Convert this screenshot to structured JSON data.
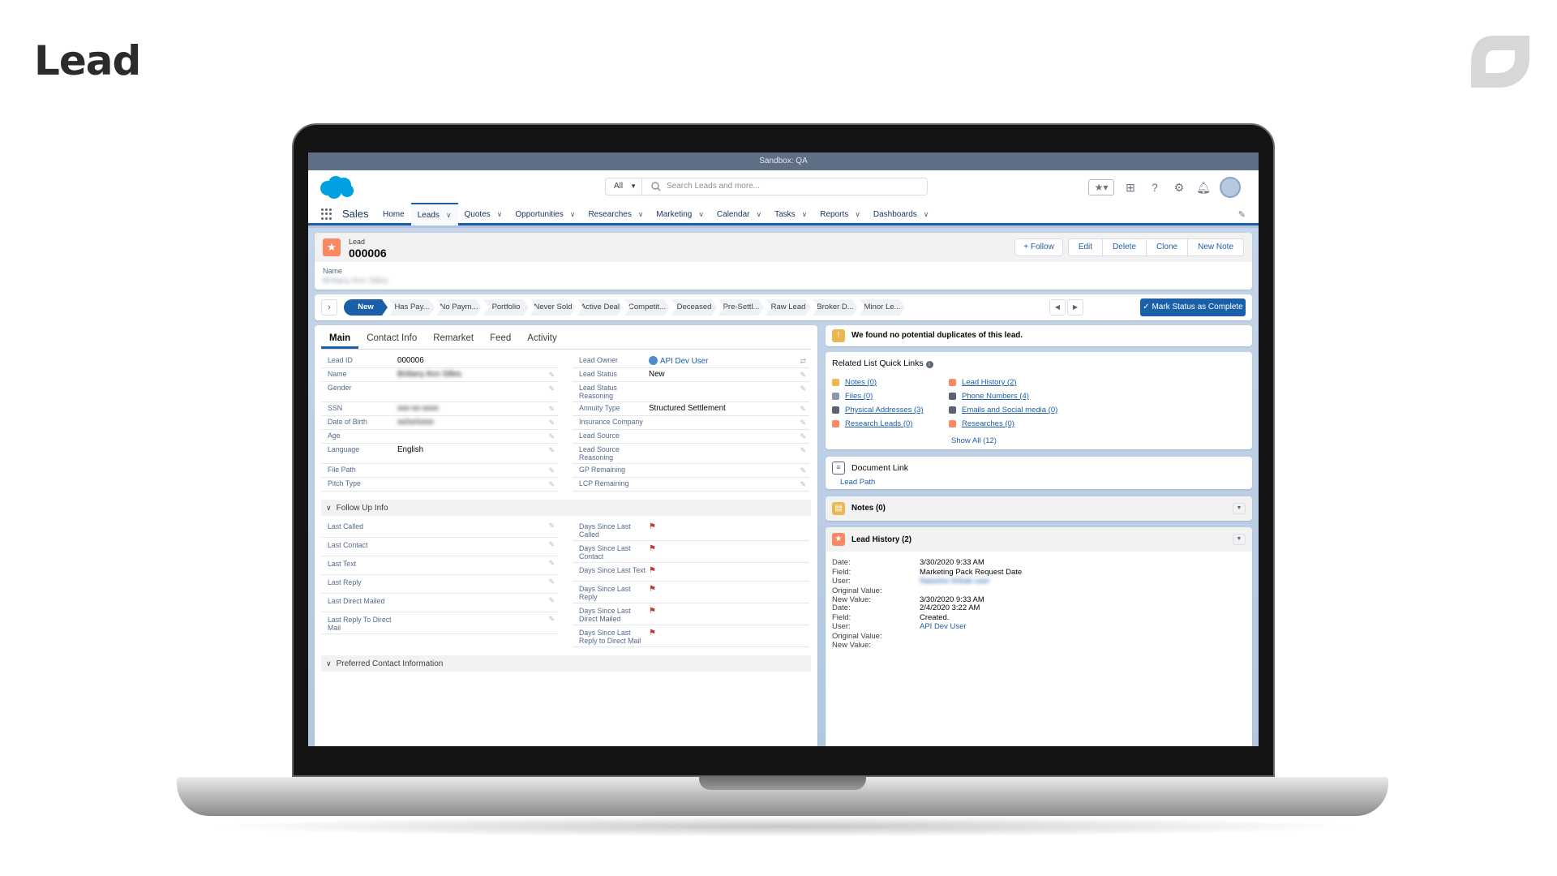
{
  "page": {
    "title": "Lead"
  },
  "sandbox": {
    "label": "Sandbox: QA"
  },
  "header": {
    "search_scope": "All",
    "search_placeholder": "Search Leads and more..."
  },
  "nav": {
    "app_name": "Sales",
    "items": [
      {
        "label": "Home",
        "has_menu": false
      },
      {
        "label": "Leads",
        "has_menu": true,
        "active": true
      },
      {
        "label": "Quotes",
        "has_menu": true
      },
      {
        "label": "Opportunities",
        "has_menu": true
      },
      {
        "label": "Researches",
        "has_menu": true
      },
      {
        "label": "Marketing",
        "has_menu": true
      },
      {
        "label": "Calendar",
        "has_menu": true
      },
      {
        "label": "Tasks",
        "has_menu": true
      },
      {
        "label": "Reports",
        "has_menu": true
      },
      {
        "label": "Dashboards",
        "has_menu": true
      }
    ]
  },
  "record": {
    "object_label": "Lead",
    "record_name": "000006",
    "actions": {
      "follow": "Follow",
      "edit": "Edit",
      "delete": "Delete",
      "clone": "Clone",
      "new_note": "New Note"
    },
    "name_label": "Name",
    "name_value": "Brittany Ann Silles"
  },
  "path": {
    "stages": [
      "New",
      "Has Pay...",
      "No Paym...",
      "Portfolio",
      "Never Sold",
      "Active Deal",
      "Competit...",
      "Deceased",
      "Pre-Settl...",
      "Raw Lead",
      "Broker D...",
      "Minor Le..."
    ],
    "mark_complete": "Mark Status as Complete"
  },
  "tabs": [
    "Main",
    "Contact Info",
    "Remarket",
    "Feed",
    "Activity"
  ],
  "details": {
    "left": [
      {
        "label": "Lead ID",
        "value": "000006",
        "editable": false
      },
      {
        "label": "Name",
        "value": "Brittany Ann Silles",
        "blurred": true,
        "editable": true
      },
      {
        "label": "Gender",
        "value": "",
        "editable": true,
        "tall": true
      },
      {
        "label": "SSN",
        "value": "xxx-xx-xxxx",
        "blurred": true,
        "editable": true
      },
      {
        "label": "Date of Birth",
        "value": "xx/xx/xxxx",
        "blurred": true,
        "editable": true
      },
      {
        "label": "Age",
        "value": "",
        "editable": true
      },
      {
        "label": "Language",
        "value": "English",
        "editable": true,
        "tall": true
      },
      {
        "label": "File Path",
        "value": "",
        "editable": true
      },
      {
        "label": "Pitch Type",
        "value": "",
        "editable": true
      }
    ],
    "right": [
      {
        "label": "Lead Owner",
        "value": "API Dev User",
        "link": true,
        "owner": true
      },
      {
        "label": "Lead Status",
        "value": "New",
        "editable": true
      },
      {
        "label": "Lead Status Reasoning",
        "value": "",
        "editable": true,
        "tall": true
      },
      {
        "label": "Annuity Type",
        "value": "Structured Settlement",
        "editable": true
      },
      {
        "label": "Insurance Company",
        "value": "",
        "editable": true
      },
      {
        "label": "Lead Source",
        "value": "",
        "editable": true
      },
      {
        "label": "Lead Source Reasoning",
        "value": "",
        "editable": true,
        "tall": true
      },
      {
        "label": "GP Remaining",
        "value": "",
        "editable": true
      },
      {
        "label": "LCP Remaining",
        "value": "",
        "editable": true
      }
    ]
  },
  "follow_up": {
    "title": "Follow Up Info",
    "left": [
      "Last Called",
      "Last Contact",
      "Last Text",
      "Last Reply",
      "Last Direct Mailed",
      "Last Reply To Direct Mail"
    ],
    "right": [
      "Days Since Last Called",
      "Days Since Last Contact",
      "Days Since Last Text",
      "Days Since Last Reply",
      "Days Since Last Direct Mailed",
      "Days Since Last Reply to Direct Mail"
    ]
  },
  "preferred_contact": {
    "title": "Preferred Contact Information"
  },
  "duplicates": {
    "message": "We found no potential duplicates of this lead."
  },
  "quick_links": {
    "title": "Related List Quick Links",
    "items": [
      {
        "label": "Notes (0)",
        "color": "#e9b94f"
      },
      {
        "label": "Lead History (2)",
        "color": "#f88962"
      },
      {
        "label": "Files (0)",
        "color": "#8a97a8"
      },
      {
        "label": "Phone Numbers (4)",
        "color": "#5a6472"
      },
      {
        "label": "Physical Addresses (3)",
        "color": "#5a6472"
      },
      {
        "label": "Emails and Social media (0)",
        "color": "#5a6472"
      },
      {
        "label": "Research Leads (0)",
        "color": "#f88962"
      },
      {
        "label": "Researches (0)",
        "color": "#f88962"
      }
    ],
    "show_all": "Show All (12)"
  },
  "document_link": {
    "title": "Document Link",
    "link": "Lead Path"
  },
  "notes": {
    "title": "Notes (0)"
  },
  "lead_history": {
    "title": "Lead History (2)",
    "entries": [
      {
        "date": "3/30/2020 9:33 AM",
        "field": "Marketing Pack Request Date",
        "user": "Natasha Sirbak-user",
        "original": "",
        "new_value": "3/30/2020 9:33 AM"
      },
      {
        "date": "2/4/2020 3:22 AM",
        "field": "Created.",
        "user": "API Dev User",
        "original": "",
        "new_value": ""
      }
    ],
    "labels": {
      "date": "Date:",
      "field": "Field:",
      "user": "User:",
      "original": "Original Value:",
      "new_value": "New Value:"
    }
  },
  "colors": {
    "brand": "#1b5fa8",
    "lead_icon": "#f88962",
    "flag": "#c23934",
    "sandbox": "#5f6f86"
  }
}
